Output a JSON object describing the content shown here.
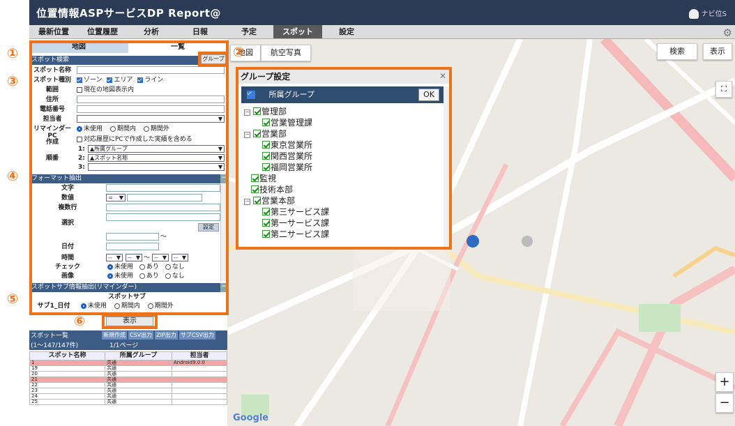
{
  "app": {
    "title": "位置情報ASPサービスDP Report@",
    "user": "ナビ位S"
  },
  "nav": [
    "最新位置",
    "位置履歴",
    "分析",
    "日報",
    "予定",
    "スポット",
    "設定"
  ],
  "tabs": {
    "map": "地図",
    "list": "一覧"
  },
  "search": {
    "header": "スポット検索",
    "group_button": "グループ",
    "name_label": "スポット名称",
    "type_label": "スポット種別",
    "type_options": [
      "ゾーン",
      "エリア",
      "ライン"
    ],
    "range_label": "範囲",
    "range_option": "現在の地図表示内",
    "address_label": "住所",
    "phone_label": "電話番号",
    "owner_label": "担当者",
    "reminder_label": "リマインダー",
    "reminder_options": [
      "未使用",
      "期間内",
      "期間外"
    ],
    "pc_label": "PC",
    "create_label": "作成",
    "pc_option": "対応履歴にPCで作成した実績を含める",
    "order_label": "順番",
    "order_items": [
      {
        "n": "1:",
        "v": "▲所属グループ"
      },
      {
        "n": "2:",
        "v": "▲スポット名称"
      },
      {
        "n": "3:",
        "v": ""
      }
    ]
  },
  "format": {
    "header": "フォーマット抽出",
    "text_label": "文字",
    "number_label": "数値",
    "number_op": "=",
    "multiline_label": "複数行",
    "select_label": "選択",
    "set_button": "設定",
    "date_label": "日付",
    "tilde": "〜",
    "time_label": "時間",
    "time_dash": "--",
    "check_label": "チェック",
    "image_label": "画像",
    "check_options": [
      "未使用",
      "あり",
      "なし"
    ]
  },
  "sub": {
    "header": "スポットサブ情報抽出(リマインダー)",
    "col": "スポットサブ",
    "label": "サブ1_日付",
    "options": [
      "未使用",
      "期間内",
      "期間外"
    ]
  },
  "show_button": "表示",
  "list": {
    "title": "スポット一覧",
    "count": "(1〜147/147件)",
    "page": "1/1ページ",
    "buttons": [
      "新規作成",
      "CSV出力",
      "ZIP出力",
      "サブCSV出力"
    ],
    "columns": [
      "スポット名称",
      "所属グループ",
      "担当者"
    ],
    "rows": [
      [
        "1",
        "共通",
        "Android9.0.0"
      ],
      [
        "19",
        "共通",
        ""
      ],
      [
        "20",
        "共通",
        ""
      ],
      [
        "21",
        "共通",
        ""
      ],
      [
        "22",
        "共通",
        ""
      ],
      [
        "23",
        "共通",
        ""
      ],
      [
        "24",
        "共通",
        ""
      ],
      [
        "25",
        "共通",
        ""
      ]
    ]
  },
  "map": {
    "types": [
      "地図",
      "航空写真"
    ],
    "search": "検索",
    "display": "表示",
    "zoom_in": "+",
    "zoom_out": "−",
    "google": "Google"
  },
  "dialog": {
    "title": "グループ設定",
    "header": "所属グループ",
    "ok": "OK",
    "tree": [
      {
        "label": "管理部",
        "level": 0,
        "exp": "−"
      },
      {
        "label": "営業管理課",
        "level": 1
      },
      {
        "label": "営業部",
        "level": 0,
        "exp": "−"
      },
      {
        "label": "東京営業所",
        "level": 1
      },
      {
        "label": "関西営業所",
        "level": 1
      },
      {
        "label": "福岡営業所",
        "level": 1
      },
      {
        "label": "監視",
        "level": 0
      },
      {
        "label": "技術本部",
        "level": 0
      },
      {
        "label": "営業本部",
        "level": 0,
        "exp": "−"
      },
      {
        "label": "第三サービス課",
        "level": 1
      },
      {
        "label": "第一サービス課",
        "level": 1
      },
      {
        "label": "第二サービス課",
        "level": 1
      }
    ]
  },
  "callouts": [
    "①",
    "②",
    "③",
    "④",
    "⑤",
    "⑥"
  ],
  "colors": {
    "accent": "#f07218",
    "header": "#2b3a55",
    "section": "#3d5c85",
    "highlight_row": "#f4a6a6"
  }
}
